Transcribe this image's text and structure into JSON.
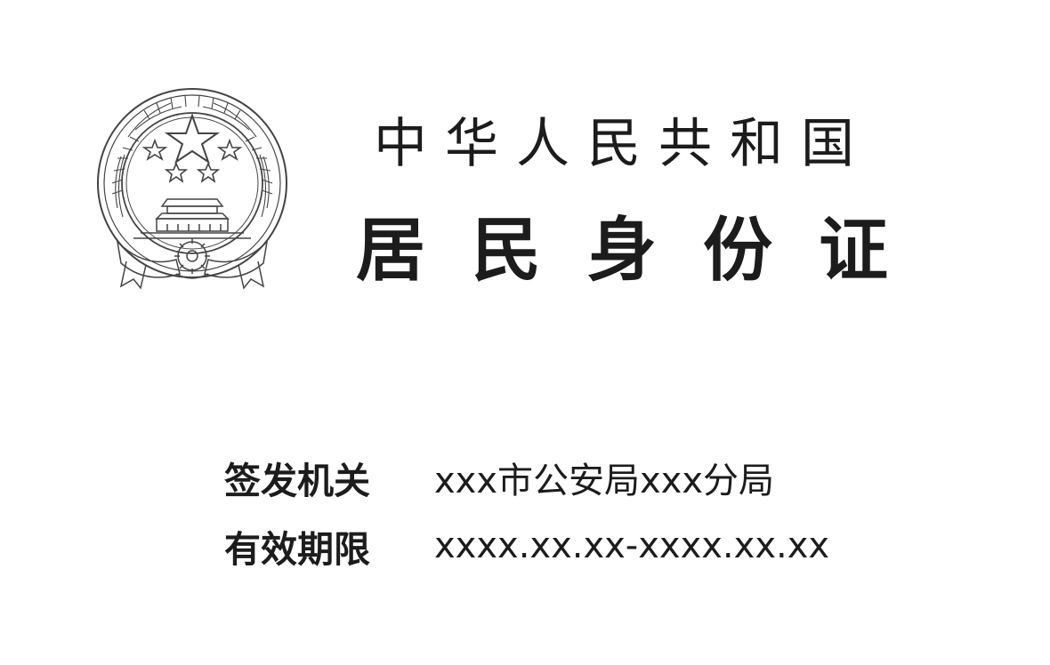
{
  "header": {
    "country": "中华人民共和国",
    "document_type": "居民身份证"
  },
  "emblem": {
    "icon": "national-emblem-icon"
  },
  "fields": {
    "issuing_authority": {
      "label": "签发机关",
      "value": "xxx市公安局xxx分局"
    },
    "validity_period": {
      "label": "有效期限",
      "value": "xxxx.xx.xx-xxxx.xx.xx"
    }
  }
}
